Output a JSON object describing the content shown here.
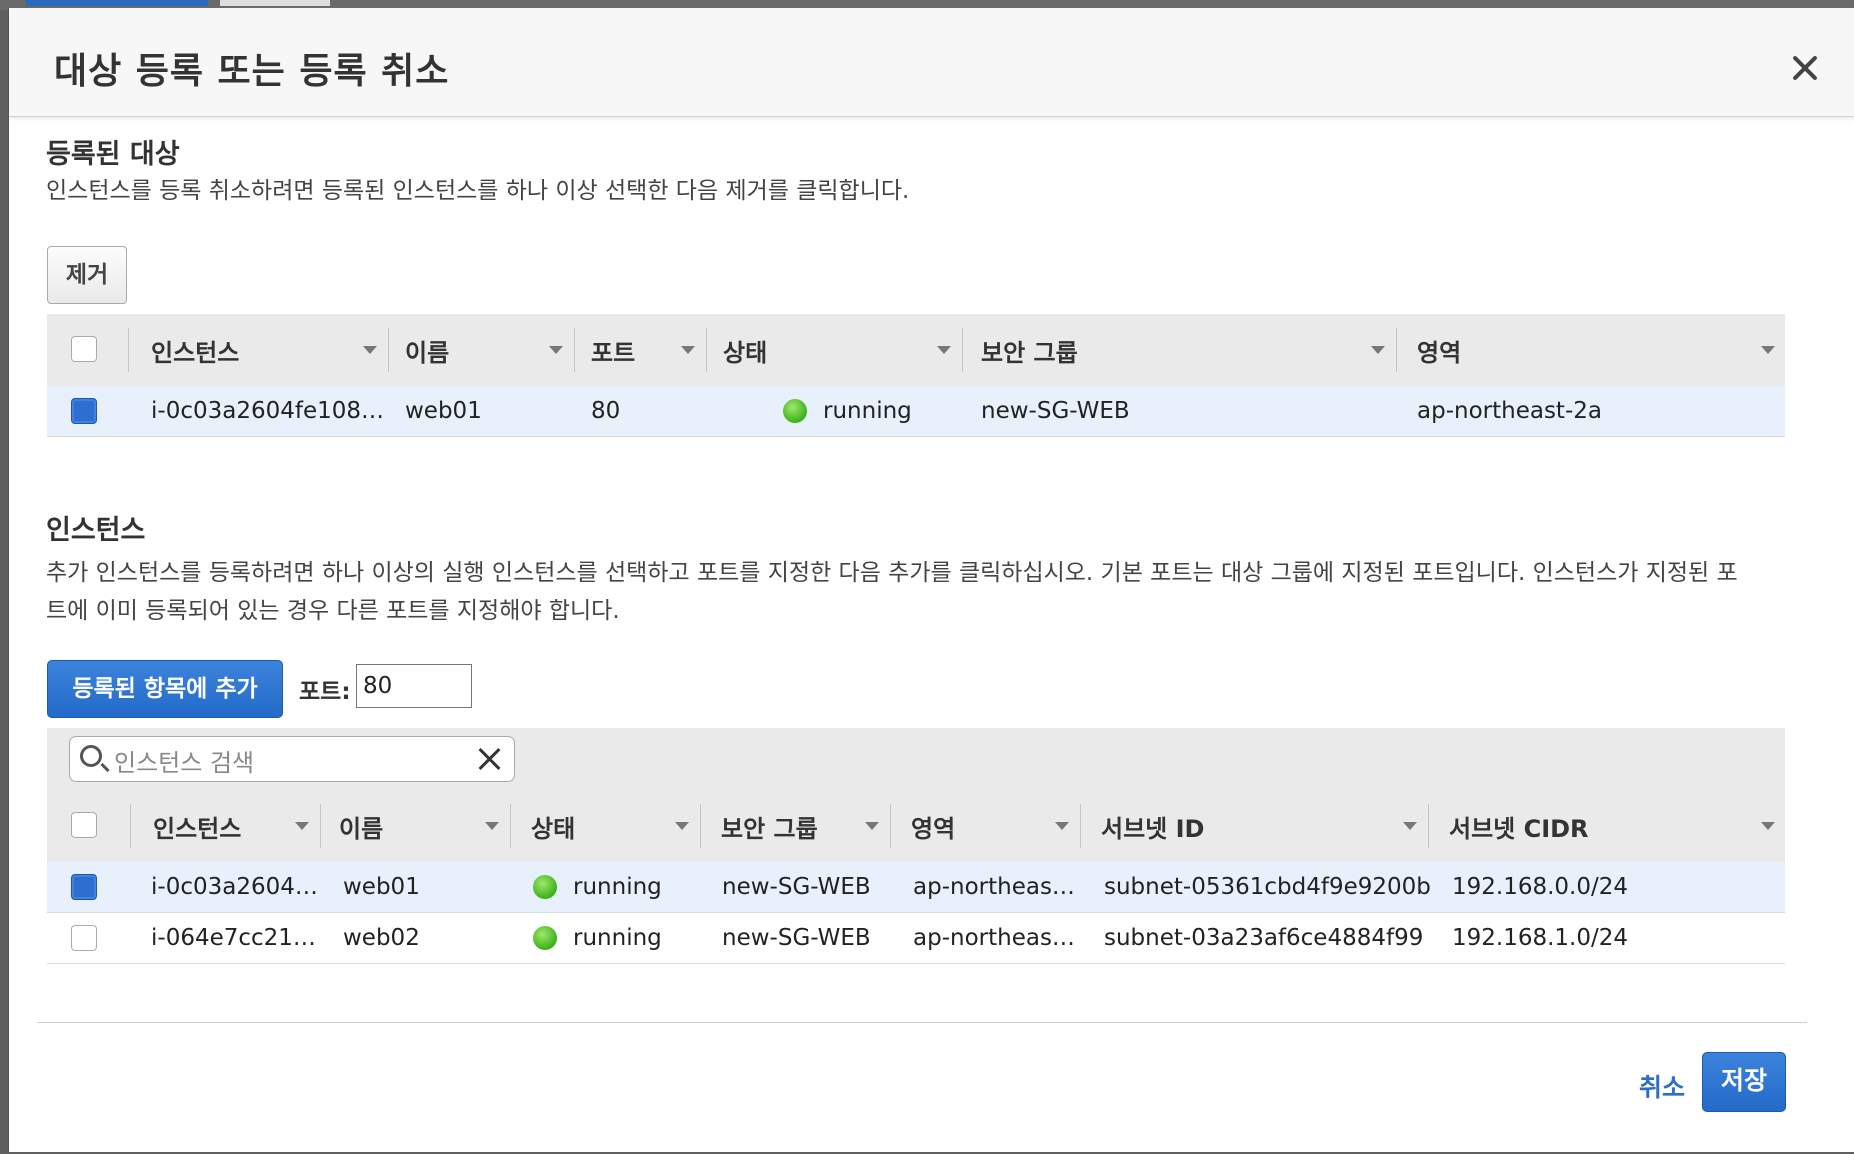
{
  "modal": {
    "title": "대상 등록 또는 등록 취소"
  },
  "registered": {
    "title": "등록된 대상",
    "description": "인스턴스를 등록 취소하려면 등록된 인스턴스를 하나 이상 선택한 다음 제거를 클릭합니다.",
    "remove_label": "제거",
    "columns": [
      "인스턴스",
      "이름",
      "포트",
      "상태",
      "보안 그룹",
      "영역"
    ],
    "rows": [
      {
        "instance": "i-0c03a2604fe108…",
        "name": "web01",
        "port": "80",
        "state": "running",
        "security_group": "new-SG-WEB",
        "zone": "ap-northeast-2a",
        "checked": true
      }
    ]
  },
  "instances": {
    "title": "인스턴스",
    "description_line1": "추가 인스턴스를 등록하려면 하나 이상의 실행 인스턴스를 선택하고 포트를 지정한 다음 추가를 클릭하십시오. 기본 포트는 대상 그룹에 지정된 포트입니다. 인스턴스가 지정된 포",
    "description_line2": "트에 이미 등록되어 있는 경우 다른 포트를 지정해야 합니다.",
    "add_label": "등록된 항목에 추가",
    "port_label": "포트:",
    "port_value": "80",
    "search_placeholder": "인스턴스 검색",
    "columns": [
      "인스턴스",
      "이름",
      "상태",
      "보안 그룹",
      "영역",
      "서브넷 ID",
      "서브넷 CIDR"
    ],
    "rows": [
      {
        "instance": "i-0c03a2604…",
        "name": "web01",
        "state": "running",
        "security_group": "new-SG-WEB",
        "zone": "ap-northeas…",
        "subnet_id": "subnet-05361cbd4f9e9200b",
        "cidr": "192.168.0.0/24",
        "checked": true
      },
      {
        "instance": "i-064e7cc21…",
        "name": "web02",
        "state": "running",
        "security_group": "new-SG-WEB",
        "zone": "ap-northeas…",
        "subnet_id": "subnet-03a23af6ce4884f99",
        "cidr": "192.168.1.0/24",
        "checked": false
      }
    ]
  },
  "footer": {
    "cancel_label": "취소",
    "save_label": "저장"
  },
  "colors": {
    "primary": "#2d6fd1",
    "running": "#3ab219",
    "selected_row": "#e7f0fb"
  }
}
